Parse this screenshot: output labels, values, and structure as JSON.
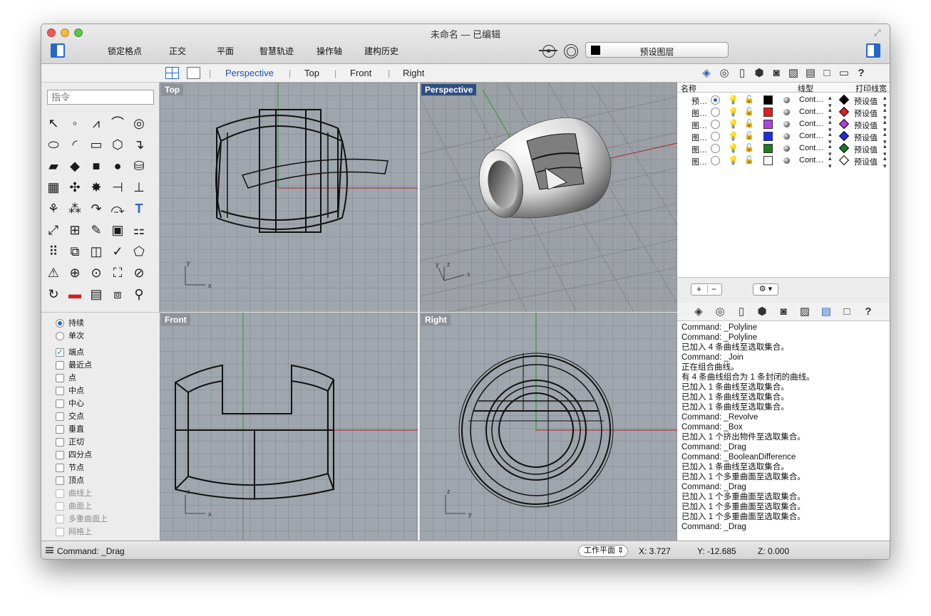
{
  "window": {
    "title": "未命名 — 已编辑"
  },
  "toolbar": {
    "osnap_buttons": [
      "锁定格点",
      "正交",
      "平面",
      "智慧轨迹",
      "操作轴",
      "建构历史"
    ],
    "layer_select": "预设图层",
    "layer_color": "#000000"
  },
  "command": {
    "placeholder": "指令"
  },
  "tool_icons": [
    "select-arrow",
    "point",
    "polyline",
    "curve",
    "circle",
    "ellipse",
    "arc",
    "rectangle",
    "polygon",
    "fillet",
    "surface",
    "extrude",
    "box",
    "sphere",
    "cylinder",
    "mesh",
    "transform",
    "explode",
    "trim",
    "split",
    "group",
    "boolean",
    "offset",
    "rebuild",
    "text",
    "dimension",
    "array",
    "layout",
    "analyze",
    "check",
    "shade",
    "paint",
    "zoom",
    "zoom-window",
    "zoom-extents",
    "zoom-selected",
    "rotate-view",
    "car",
    "grid",
    "cplane",
    "light"
  ],
  "osnap": {
    "mode_items": [
      {
        "label": "持续",
        "on": true
      },
      {
        "label": "单次",
        "on": false
      }
    ],
    "snap_items": [
      {
        "label": "端点",
        "checked": true,
        "dim": false
      },
      {
        "label": "最近点",
        "checked": false,
        "dim": false
      },
      {
        "label": "点",
        "checked": false,
        "dim": false
      },
      {
        "label": "中点",
        "checked": false,
        "dim": false
      },
      {
        "label": "中心",
        "checked": false,
        "dim": false
      },
      {
        "label": "交点",
        "checked": false,
        "dim": false
      },
      {
        "label": "垂直",
        "checked": false,
        "dim": false
      },
      {
        "label": "正切",
        "checked": false,
        "dim": false
      },
      {
        "label": "四分点",
        "checked": false,
        "dim": false
      },
      {
        "label": "节点",
        "checked": false,
        "dim": false
      },
      {
        "label": "顶点",
        "checked": false,
        "dim": false
      },
      {
        "label": "曲线上",
        "checked": false,
        "dim": true
      },
      {
        "label": "曲面上",
        "checked": false,
        "dim": true
      },
      {
        "label": "多重曲面上",
        "checked": false,
        "dim": true
      },
      {
        "label": "网格上",
        "checked": false,
        "dim": true
      }
    ]
  },
  "viewport_tabs": [
    "Perspective",
    "Top",
    "Front",
    "Right"
  ],
  "viewports": {
    "top": "Top",
    "perspective": "Perspective",
    "front": "Front",
    "right": "Right"
  },
  "axis_labels": {
    "x": "x",
    "y": "y",
    "z": "z"
  },
  "layers": {
    "columns": {
      "name": "名称",
      "linetype": "线型",
      "print_width": "打印线宽"
    },
    "rows": [
      {
        "name": "预…",
        "current": true,
        "color": "#000000",
        "linetype": "Cont…",
        "print_width": "预设值"
      },
      {
        "name": "图…",
        "current": false,
        "color": "#e02020",
        "linetype": "Cont…",
        "print_width": "预设值"
      },
      {
        "name": "图…",
        "current": false,
        "color": "#b040e0",
        "linetype": "Cont…",
        "print_width": "预设值"
      },
      {
        "name": "图…",
        "current": false,
        "color": "#1a2ee8",
        "linetype": "Cont…",
        "print_width": "预设值"
      },
      {
        "name": "图…",
        "current": false,
        "color": "#1f7a1f",
        "linetype": "Cont…",
        "print_width": "预设值"
      },
      {
        "name": "图…",
        "current": false,
        "color": "#ffffff",
        "linetype": "Cont…",
        "print_width": "预设值"
      }
    ],
    "footer": {
      "add": "+",
      "remove": "−",
      "gear": "⚙ ▾"
    }
  },
  "history": [
    "Command: _Polyline",
    "Command: _Polyline",
    "已加入 4 条曲线至选取集合。",
    "Command: _Join",
    "正在组合曲线。",
    "有 4 条曲线组合为 1 条封闭的曲线。",
    "已加入 1 条曲线至选取集合。",
    "已加入 1 条曲线至选取集合。",
    "已加入 1 条曲线至选取集合。",
    "Command: _Revolve",
    "Command: _Box",
    "已加入 1 个挤出物件至选取集合。",
    "Command: _Drag",
    "Command: _BooleanDifference",
    "已加入 1 条曲线至选取集合。",
    "已加入 1 个多重曲面至选取集合。",
    "Command: _Drag",
    "已加入 1 个多重曲面至选取集合。",
    "已加入 1 个多重曲面至选取集合。",
    "已加入 1 个多重曲面至选取集合。",
    "Command: _Drag"
  ],
  "status": {
    "command": "Command: _Drag",
    "cplane": "工作平面 ⇕",
    "x": "X: 3.727",
    "y": "Y: -12.685",
    "z": "Z: 0.000"
  }
}
